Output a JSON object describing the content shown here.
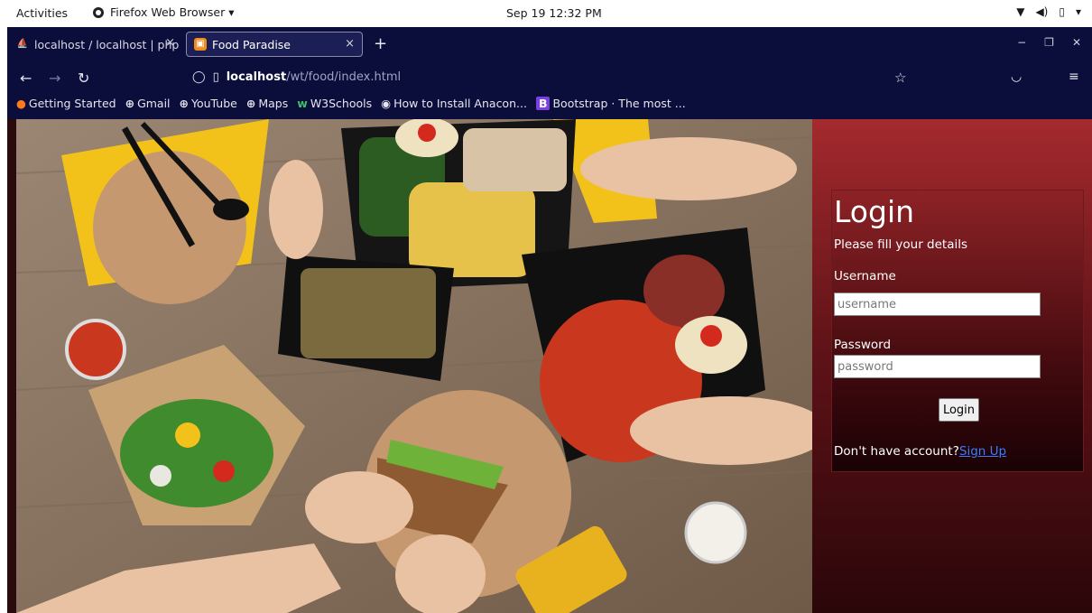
{
  "topbar": {
    "activities": "Activities",
    "app_name": "Firefox Web Browser ▾",
    "clock": "Sep 19 12:32 PM",
    "system_icons": [
      "wifi-icon",
      "volume-icon",
      "battery-icon",
      "chevron-down-icon"
    ]
  },
  "browser": {
    "tabs": [
      {
        "label": "localhost / localhost | php",
        "icon": "phpmyadmin-icon"
      },
      {
        "label": "Food Paradise",
        "icon": "food-site-icon"
      }
    ],
    "url_host": "localhost",
    "url_path": "/wt/food/index.html",
    "bookmarks": [
      {
        "label": "Getting Started",
        "icon": "firefox-icon"
      },
      {
        "label": "Gmail",
        "icon": "globe-icon"
      },
      {
        "label": "YouTube",
        "icon": "globe-icon"
      },
      {
        "label": "Maps",
        "icon": "globe-icon"
      },
      {
        "label": "W3Schools",
        "icon": "w3schools-icon"
      },
      {
        "label": "How to Install Anacon...",
        "icon": "site-icon"
      },
      {
        "label": "Bootstrap · The most ...",
        "icon": "bootstrap-icon"
      }
    ]
  },
  "login": {
    "title": "Login",
    "subtitle": "Please fill your details",
    "username_label": "Username",
    "username_placeholder": "username",
    "password_label": "Password",
    "password_placeholder": "password",
    "button_label": "Login",
    "signup_prompt": "Don't have account?",
    "signup_link": "Sign Up"
  },
  "colors": {
    "browser_chrome": "#0b0d3a",
    "panel_top": "#a42a2e",
    "panel_bottom": "#2a0609",
    "link": "#3d7bff"
  }
}
